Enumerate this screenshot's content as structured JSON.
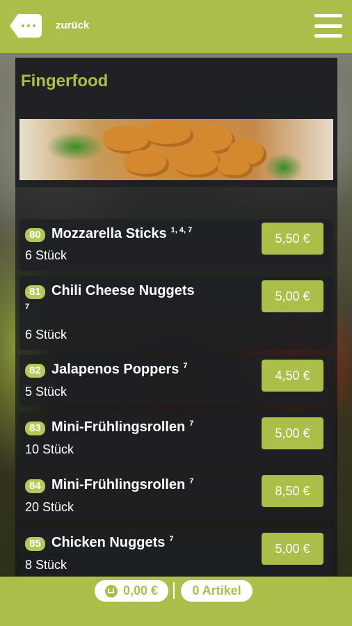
{
  "header": {
    "back_label": "zurück"
  },
  "section": {
    "title": "Fingerfood"
  },
  "items": [
    {
      "number": "80",
      "name": "Mozzarella Sticks",
      "allergens": "1, 4, 7",
      "description": "6 Stück",
      "price": "5,50 €"
    },
    {
      "number": "81",
      "name": "Chili Cheese Nuggets",
      "allergens": "7",
      "description": "6 Stück",
      "price": "5,00 €"
    },
    {
      "number": "82",
      "name": "Jalapenos Poppers",
      "allergens": "7",
      "description": "5 Stück",
      "price": "4,50 €"
    },
    {
      "number": "83",
      "name": "Mini-Frühlingsrollen",
      "allergens": "7",
      "description": "10 Stück",
      "price": "5,00 €"
    },
    {
      "number": "84",
      "name": "Mini-Frühlingsrollen",
      "allergens": "7",
      "description": "20 Stück",
      "price": "8,50 €"
    },
    {
      "number": "85",
      "name": "Chicken Nuggets",
      "allergens": "7",
      "description": "8 Stück",
      "price": "5,00 €"
    }
  ],
  "footer": {
    "cart_total": "0,00 €",
    "article_count": "0 Artikel"
  },
  "colors": {
    "accent": "#aabf4a",
    "panel": "#1e2024"
  }
}
